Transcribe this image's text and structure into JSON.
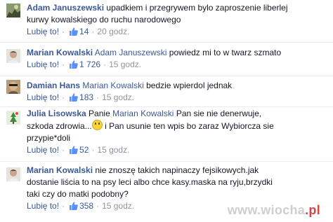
{
  "comments": [
    {
      "author": "Adam Januszewski",
      "mention": "",
      "text_lines": [
        "upadkiem i przegrywem bylo zaproszenie liberlej",
        "kurwy kowalskiego do ruchu narodowego"
      ],
      "like_label": "Lubię to!",
      "likes": "14",
      "time": "20 godz."
    },
    {
      "author": "Marian Kowalski",
      "mention": "Adam Januszewski",
      "text_lines": [
        "powiedz mi to w twarz szmato"
      ],
      "like_label": "Lubię to!",
      "likes": "1 726",
      "time": "15 godz."
    },
    {
      "author": "Damian Hans",
      "mention": "Marian Kowalski",
      "text_lines": [
        "bedzie wpierdol jednak"
      ],
      "like_label": "Lubię to!",
      "likes": "183",
      "time": "15 godz."
    },
    {
      "author": "Julia Lisowska",
      "mention": "Marian Kowalski",
      "text_pre": "Panie",
      "text_lines": [
        "Pan sie nie denerwuje,",
        "szkoda zdrowia...",
        "i Pan usunie ten wpis bo zaraz Wybiorcza sie",
        "przypie*doli"
      ],
      "like_label": "Lubię to!",
      "likes": "52",
      "time": "15 godz."
    },
    {
      "author": "Marian Kowalski",
      "mention": "",
      "text_lines": [
        "nie znoszę takich napinaczy fejsikowych.jak",
        "dostanie liścia to na psy leci albo chce kasy.maska na ryju,brzydki",
        "taki czy do matki podobny?"
      ],
      "like_label": "Lubię to!",
      "likes": "358",
      "time": "15 godz."
    }
  ],
  "watermark": {
    "main": "www.wiocha",
    "accent": ".pl"
  },
  "colors": {
    "link": "#3b5998",
    "meta": "#90949c",
    "text": "#141823"
  }
}
